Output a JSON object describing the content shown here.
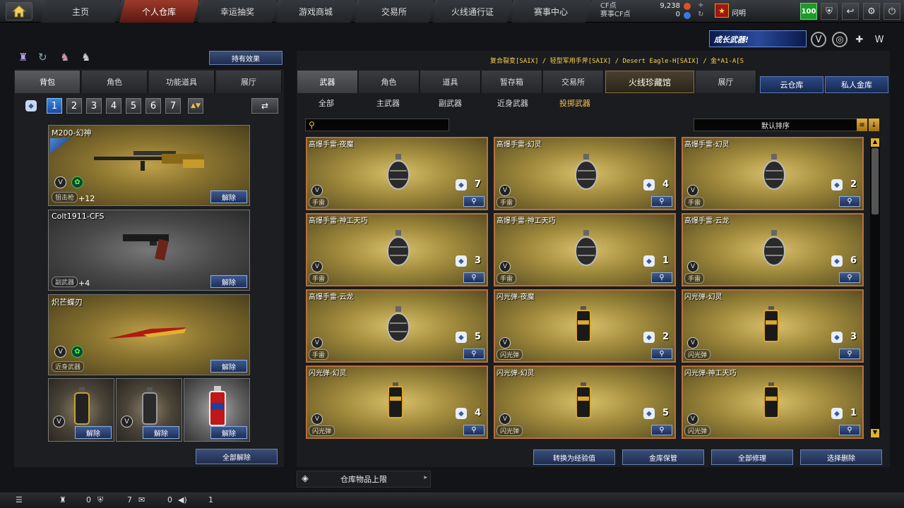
{
  "nav": {
    "tabs": [
      "主页",
      "个人仓库",
      "幸运抽奖",
      "游戏商城",
      "交易所",
      "火线通行证",
      "赛事中心"
    ],
    "active": 1
  },
  "currency": {
    "cf_label": "CF点",
    "cf_value": "9,238",
    "event_cf_label": "赛事CF点",
    "event_cf_value": "0"
  },
  "user": {
    "rank_glyph": "★",
    "name": "问明",
    "level": "100"
  },
  "banner": {
    "text": "成长武器!"
  },
  "left": {
    "effect_button": "持有效果",
    "tabs": [
      "背包",
      "角色",
      "功能道具",
      "展厅"
    ],
    "pages": [
      "1",
      "2",
      "3",
      "4",
      "5",
      "6",
      "7"
    ],
    "active_page": 0,
    "slots": [
      {
        "name": "M200-幻神",
        "type": "狙击枪",
        "count": "+12",
        "unequip": "解除"
      },
      {
        "name": "Colt1911-CFS",
        "type": "副武器",
        "count": "+4",
        "unequip": "解除"
      },
      {
        "name": "炽芒蝶刃",
        "type": "近身武器",
        "count": "",
        "unequip": "解除"
      }
    ],
    "grenade_unequip": [
      "解除",
      "解除",
      "解除"
    ],
    "unequip_all": "全部解除"
  },
  "breadcrumb": "复合裂变[SAIX] / 轻型军用手斧[SAIX] / Desert Eagle-H[SAIX] / 金*A1-A[S",
  "right": {
    "tabs": [
      "武器",
      "角色",
      "道具",
      "暂存箱",
      "交易所",
      "火线珍藏馆",
      "展厅"
    ],
    "active_tab": 0,
    "blue_tabs": [
      "云仓库",
      "私人金库"
    ],
    "sub_tabs": [
      "全部",
      "主武器",
      "副武器",
      "近身武器",
      "投掷武器"
    ],
    "active_sub": 4,
    "sort_label": "默认排序",
    "items": [
      {
        "name": "高爆手雷-夜魔",
        "type": "手雷",
        "qty": "7"
      },
      {
        "name": "高爆手雷-幻灵",
        "type": "手雷",
        "qty": "4"
      },
      {
        "name": "高爆手雷-幻灵",
        "type": "手雷",
        "qty": "2"
      },
      {
        "name": "高爆手雷-神工天巧",
        "type": "手雷",
        "qty": "3"
      },
      {
        "name": "高爆手雷-神工天巧",
        "type": "手雷",
        "qty": "1"
      },
      {
        "name": "高爆手雷-云龙",
        "type": "手雷",
        "qty": "6"
      },
      {
        "name": "高爆手雷-云龙",
        "type": "手雷",
        "qty": "5"
      },
      {
        "name": "闪光弹-夜魔",
        "type": "闪光弹",
        "qty": "2"
      },
      {
        "name": "闪光弹-幻灵",
        "type": "闪光弹",
        "qty": "3"
      },
      {
        "name": "闪光弹-幻灵",
        "type": "闪光弹",
        "qty": "4"
      },
      {
        "name": "闪光弹-幻灵",
        "type": "闪光弹",
        "qty": "5"
      },
      {
        "name": "闪光弹-神工天巧",
        "type": "闪光弹",
        "qty": "1"
      }
    ],
    "actions": [
      "转换为经验值",
      "金库保管",
      "全部修理",
      "选择删除"
    ],
    "limit_label": "仓库物品上限"
  },
  "status": {
    "friends": "0",
    "guild": "7",
    "chat": "0",
    "volume": "1"
  },
  "colors": {
    "active_nav": "#9b3a2a",
    "accent_blue": "#2c4a86",
    "card_border": "#b8703a",
    "highlight": "#ffc24a"
  }
}
